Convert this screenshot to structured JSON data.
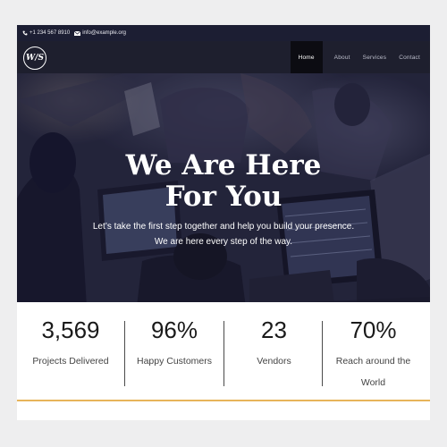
{
  "topbar": {
    "phone": "+1 234 567 8910",
    "email": "info@example.org",
    "phone_icon": "phone-icon",
    "email_icon": "envelope-icon"
  },
  "brand": {
    "logo_text": "W/S"
  },
  "nav": {
    "items": [
      {
        "label": "Home",
        "active": true
      },
      {
        "label": "About",
        "active": false
      },
      {
        "label": "Services",
        "active": false
      },
      {
        "label": "Contact",
        "active": false
      }
    ]
  },
  "hero": {
    "title_line1": "We Are Here",
    "title_line2": "For You",
    "subtitle_line1": "Let’s take the first step together and help you build your presence.",
    "subtitle_line2": "We are here every step of the way."
  },
  "stats": [
    {
      "number": "3,569",
      "label": "Projects Delivered"
    },
    {
      "number": "96%",
      "label": "Happy Customers"
    },
    {
      "number": "23",
      "label": "Vendors"
    },
    {
      "number": "70%",
      "label": "Reach around the",
      "label2": "World"
    }
  ],
  "colors": {
    "page_bg": "#eeeeef",
    "topbar_bg": "#1c1e33",
    "navbar_bg": "#1e1f2e",
    "nav_active_bg": "#0c0c12",
    "accent_line": "#e7b45a"
  }
}
